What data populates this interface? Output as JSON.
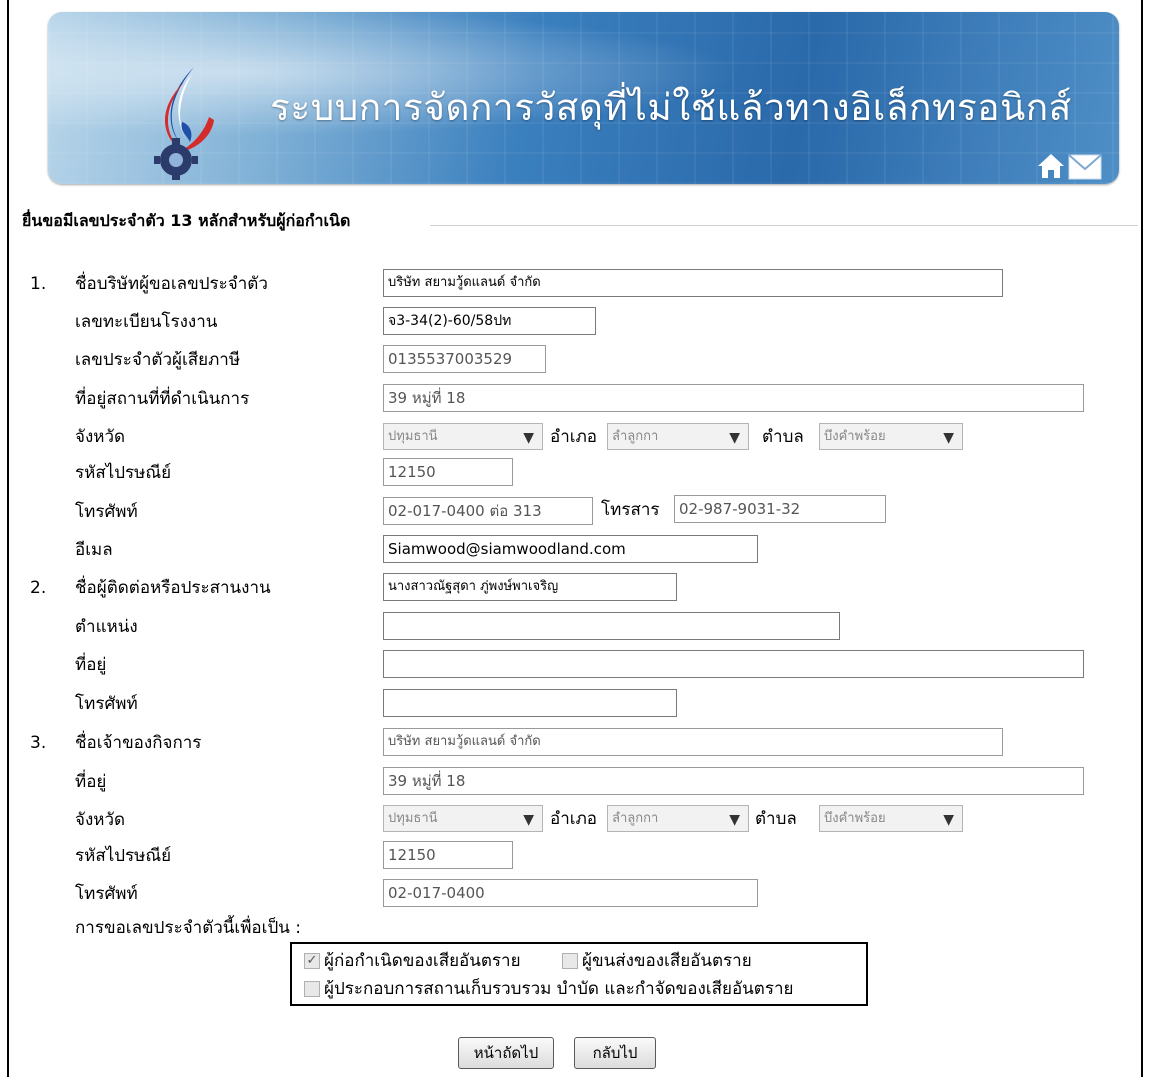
{
  "header": {
    "title": "ระบบการจัดการวัสดุที่ไม่ใช้แล้วทางอิเล็กทรอนิกส์"
  },
  "form": {
    "section_title": "ยื่นขอมีเลขประจำตัว 13 หลักสำหรับผู้ก่อกำเนิด",
    "s1": {
      "num": "1.",
      "company_label": "ชื่อบริษัทผู้ขอเลขประจำตัว",
      "company_value": "บริษัท สยามวู้ดแลนด์ จำกัด",
      "factory_reg_label": "เลขทะเบียนโรงงาน",
      "factory_reg_value": "จ3-34(2)-60/58ปท",
      "tax_label": "เลขประจำตัวผู้เสียภาษี",
      "tax_value": "0135537003529",
      "address_label": "ที่อยู่สถานที่ที่ดำเนินการ",
      "address_value": "39 หมู่ที่ 18",
      "province_label": "จังหวัด",
      "province_value": "ปทุมธานี",
      "district_label": "อำเภอ",
      "district_value": "ลำลูกกา",
      "subdistrict_label": "ตำบล",
      "subdistrict_value": "บึงคำพร้อย",
      "postal_label": "รหัสไปรษณีย์",
      "postal_value": "12150",
      "phone_label": "โทรศัพท์",
      "phone_value": "02-017-0400 ต่อ 313",
      "fax_label": "โทรสาร",
      "fax_value": "02-987-9031-32",
      "email_label": "อีเมล",
      "email_value": "Siamwood@siamwoodland.com"
    },
    "s2": {
      "num": "2.",
      "contact_label": "ชื่อผู้ติดต่อหรือประสานงาน",
      "contact_value": "นางสาวณัฐสุดา ภู่พงษ์พาเจริญ",
      "position_label": "ตำแหน่ง",
      "position_value": "",
      "address_label": "ที่อยู่",
      "address_value": "",
      "phone_label": "โทรศัพท์",
      "phone_value": ""
    },
    "s3": {
      "num": "3.",
      "owner_label": "ชื่อเจ้าของกิจการ",
      "owner_value": "บริษัท สยามวู้ดแลนด์ จำกัด",
      "address_label": "ที่อยู่",
      "address_value": "39 หมู่ที่ 18",
      "province_label": "จังหวัด",
      "province_value": "ปทุมธานี",
      "district_label": "อำเภอ",
      "district_value": "ลำลูกกา",
      "subdistrict_label": "ตำบล",
      "subdistrict_value": "บึงคำพร้อย",
      "postal_label": "รหัสไปรษณีย์",
      "postal_value": "12150",
      "phone_label": "โทรศัพท์",
      "phone_value": "02-017-0400"
    },
    "purpose_label": "การขอเลขประจำตัวนี้เพื่อเป็น :",
    "purpose_options": [
      {
        "label": "ผู้ก่อกำเนิดของเสียอันตราย",
        "checked": true
      },
      {
        "label": "ผู้ขนส่งของเสียอันตราย",
        "checked": false
      },
      {
        "label": "ผู้ประกอบการสถานเก็บรวบรวม บำบัด และกำจัดของเสียอันตราย",
        "checked": false
      }
    ],
    "next_button": "หน้าถัดไป",
    "back_button": "กลับไป"
  },
  "colors": {
    "banner_blue": "#2a69aa",
    "logo_red": "#d42b2b",
    "logo_blue": "#1f4fa8"
  },
  "icons": [
    "logo-emblem",
    "home-icon",
    "mail-icon"
  ]
}
